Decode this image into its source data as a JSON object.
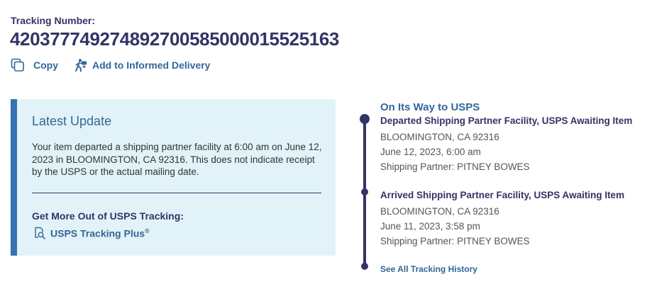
{
  "tracking": {
    "label": "Tracking Number:",
    "number": "420377749274892700585000015525163"
  },
  "actions": {
    "copy_label": "Copy",
    "informed_delivery_label": "Add to Informed Delivery"
  },
  "latest_update": {
    "title": "Latest Update",
    "body": "Your item departed a shipping partner facility at 6:00 am on June 12, 2023 in BLOOMINGTON, CA 92316. This does not indicate receipt by the USPS or the actual mailing date.",
    "promo_heading": "Get More Out of USPS Tracking:",
    "promo_link": "USPS Tracking Plus",
    "promo_link_mark": "®"
  },
  "timeline": {
    "status": "On Its Way to USPS",
    "events": [
      {
        "title": "Departed Shipping Partner Facility, USPS Awaiting Item",
        "location": "BLOOMINGTON, CA 92316",
        "datetime": "June 12, 2023, 6:00 am",
        "partner": "Shipping Partner: PITNEY BOWES"
      },
      {
        "title": "Arrived Shipping Partner Facility, USPS Awaiting Item",
        "location": "BLOOMINGTON, CA 92316",
        "datetime": "June 11, 2023, 3:58 pm",
        "partner": "Shipping Partner: PITNEY BOWES"
      }
    ],
    "history_link": "See All Tracking History"
  },
  "colors": {
    "navy": "#333366",
    "link_blue": "#336699",
    "panel_bg": "#e1f3f8",
    "panel_accent": "#3573b1"
  },
  "icons": {
    "copy": "copy-icon",
    "informed_delivery": "informed-delivery-icon",
    "tracking_plus": "tracking-plus-icon"
  }
}
